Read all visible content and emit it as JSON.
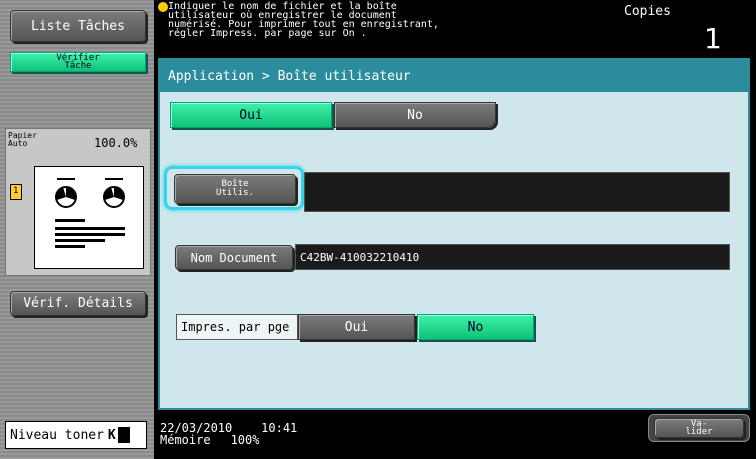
{
  "left": {
    "job_list_label": "Liste Tâches",
    "check_job_label_line1": "Vérifier",
    "check_job_label_line2": "Tâche",
    "paper_label_line1": "Papier",
    "paper_label_line2": "Auto",
    "zoom": "100.0%",
    "preview_count": "1",
    "check_details_label": "Vérif. Détails",
    "toner_label": "Niveau toner",
    "toner_color": "K"
  },
  "header": {
    "message_line1": "Indiquer le nom de fichier et la boîte",
    "message_line2": "utilisateur où enregistrer le document",
    "message_line3": "numérisé. Pour imprimer tout en enregistrant,",
    "message_line4": "régler  Impress. par page  sur  On .",
    "copies_label": "Copies",
    "copies_count": "1"
  },
  "main": {
    "breadcrumb": "Application > Boîte utilisateur",
    "top_toggle": {
      "yes": "Oui",
      "no": "No",
      "selected": "yes"
    },
    "user_box_button_line1": "Boîte",
    "user_box_button_line2": "Utilis.",
    "user_box_value": "",
    "doc_name_label": "Nom Document",
    "doc_name_value": "C42BW-410032210410",
    "print_per_page_label": "Impres. par pge",
    "print_toggle": {
      "yes": "Oui",
      "no": "No",
      "selected": "no"
    }
  },
  "footer": {
    "datetime": "22/03/2010    10:41",
    "memory_label": "Mémoire",
    "memory_value": "100%",
    "validate_line1": "Va-",
    "validate_line2": "lider"
  },
  "colors": {
    "accent_teal": "#2a8c9c",
    "panel": "#cfe6ec",
    "green": "#1fd98f"
  }
}
